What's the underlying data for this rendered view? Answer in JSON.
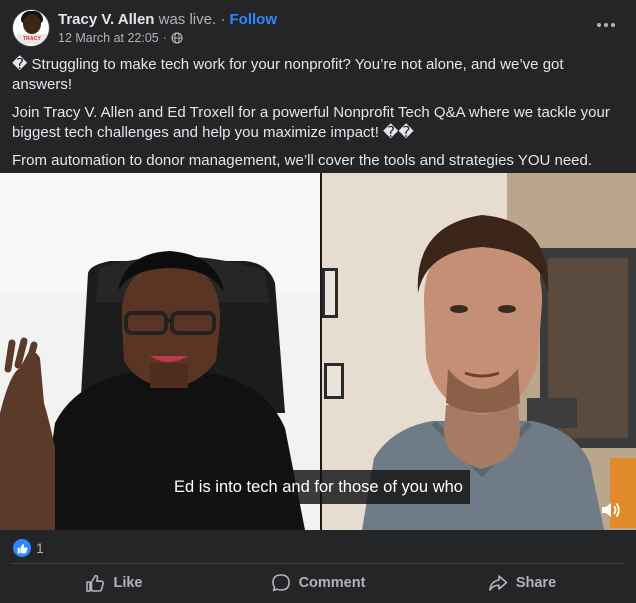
{
  "post": {
    "author": "Tracy V. Allen",
    "action": "was live.",
    "separator": "·",
    "follow_label": "Follow",
    "timestamp": "12 March at 22:05",
    "meta_separator": "·",
    "privacy_icon": "globe-icon",
    "avatar_badge": "TRACY",
    "paragraphs": [
      "� Struggling to make tech work for your nonprofit? You’re not alone, and we’ve got answers!",
      "Join Tracy V. Allen and Ed Troxell for a powerful Nonprofit Tech Q&A where we tackle your biggest tech challenges and help you maximize impact! ��",
      "From automation to donor management, we’ll cover the tools and strategies YOU need. Drop your questions and let’s get to work!"
    ]
  },
  "video": {
    "caption": "Ed is into tech and for those of you who",
    "volume_icon": "volume-icon"
  },
  "reactions": {
    "icon": "like-reaction-icon",
    "count": "1"
  },
  "action_bar": {
    "like_label": "Like",
    "comment_label": "Comment",
    "share_label": "Share"
  },
  "colors": {
    "background": "#242526",
    "text_primary": "#e4e6eb",
    "text_secondary": "#b0b3b8",
    "accent": "#2d88ff",
    "divider": "#3e4042"
  }
}
